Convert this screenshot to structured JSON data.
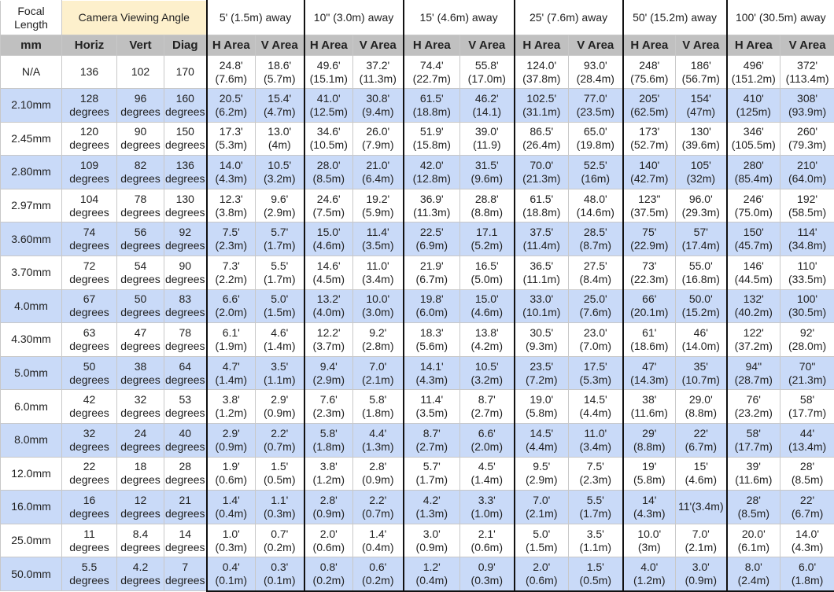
{
  "header": {
    "focal_length": "Focal Length",
    "camera_viewing_angle": "Camera Viewing Angle",
    "distances": [
      "5' (1.5m) away",
      "10\" (3.0m) away",
      "15' (4.6m) away",
      "25' (7.6m) away",
      "50' (15.2m) away",
      "100' (30.5m) away"
    ]
  },
  "subheader": {
    "mm": "mm",
    "horiz": "Horiz",
    "vert": "Vert",
    "diag": "Diag",
    "h_area": "H Area",
    "v_area": "V Area"
  },
  "colors": {
    "angle_header_bg": "#fdf0cc",
    "subheader_bg": "#c0c0c0",
    "stripe_bg": "#c9daf8"
  },
  "rows": [
    {
      "focal": "N/A",
      "horiz": [
        "136"
      ],
      "vert": [
        "102"
      ],
      "diag": [
        "170"
      ],
      "areas": [
        [
          "24.8'",
          "(7.6m)"
        ],
        [
          "18.6'",
          "(5.7m)"
        ],
        [
          "49.6'",
          "(15.1m)"
        ],
        [
          "37.2'",
          "(11.3m)"
        ],
        [
          "74.4'",
          "(22.7m)"
        ],
        [
          "55.8'",
          "(17.0m)"
        ],
        [
          "124.0'",
          "(37.8m)"
        ],
        [
          "93.0'",
          "(28.4m)"
        ],
        [
          "248'",
          "(75.6m)"
        ],
        [
          "186'",
          "(56.7m)"
        ],
        [
          "496'",
          "(151.2m)"
        ],
        [
          "372'",
          "(113.4m)"
        ]
      ]
    },
    {
      "focal": "2.10mm",
      "horiz": [
        "128",
        "degrees"
      ],
      "vert": [
        "96",
        "degrees"
      ],
      "diag": [
        "160",
        "degrees"
      ],
      "areas": [
        [
          "20.5'",
          "(6.2m)"
        ],
        [
          "15.4'",
          "(4.7m)"
        ],
        [
          "41.0'",
          "(12.5m)"
        ],
        [
          "30.8'",
          "(9.4m)"
        ],
        [
          "61.5'",
          "(18.8m)"
        ],
        [
          "46.2'",
          "(14.1)"
        ],
        [
          "102.5'",
          "(31.1m)"
        ],
        [
          "77.0'",
          "(23.5m)"
        ],
        [
          "205'",
          "(62.5m)"
        ],
        [
          "154'",
          "(47m)"
        ],
        [
          "410'",
          "(125m)"
        ],
        [
          "308'",
          "(93.9m)"
        ]
      ]
    },
    {
      "focal": "2.45mm",
      "horiz": [
        "120",
        "degrees"
      ],
      "vert": [
        "90",
        "degrees"
      ],
      "diag": [
        "150",
        "degrees"
      ],
      "areas": [
        [
          "17.3'",
          "(5.3m)"
        ],
        [
          "13.0'",
          "(4m)"
        ],
        [
          "34.6'",
          "(10.5m)"
        ],
        [
          "26.0'",
          "(7.9m)"
        ],
        [
          "51.9'",
          "(15.8m)"
        ],
        [
          "39.0'",
          "(11.9)"
        ],
        [
          "86.5'",
          "(26.4m)"
        ],
        [
          "65.0'",
          "(19.8m)"
        ],
        [
          "173'",
          "(52.7m)"
        ],
        [
          "130'",
          "(39.6m)"
        ],
        [
          "346'",
          "(105.5m)"
        ],
        [
          "260'",
          "(79.3m)"
        ]
      ]
    },
    {
      "focal": "2.80mm",
      "horiz": [
        "109",
        "degrees"
      ],
      "vert": [
        "82",
        "degrees"
      ],
      "diag": [
        "136",
        "degrees"
      ],
      "areas": [
        [
          "14.0'",
          "(4.3m)"
        ],
        [
          "10.5'",
          "(3.2m)"
        ],
        [
          "28.0'",
          "(8.5m)"
        ],
        [
          "21.0'",
          "(6.4m)"
        ],
        [
          "42.0'",
          "(12.8m)"
        ],
        [
          "31.5'",
          "(9.6m)"
        ],
        [
          "70.0'",
          "(21.3m)"
        ],
        [
          "52.5'",
          "(16m)"
        ],
        [
          "140'",
          "(42.7m)"
        ],
        [
          "105'",
          "(32m)"
        ],
        [
          "280'",
          "(85.4m)"
        ],
        [
          "210'",
          "(64.0m)"
        ]
      ]
    },
    {
      "focal": "2.97mm",
      "horiz": [
        "104",
        "degrees"
      ],
      "vert": [
        "78",
        "degrees"
      ],
      "diag": [
        "130",
        "degrees"
      ],
      "areas": [
        [
          "12.3'",
          "(3.8m)"
        ],
        [
          "9.6'",
          "(2.9m)"
        ],
        [
          "24.6'",
          "(7.5m)"
        ],
        [
          "19.2'",
          "(5.9m)"
        ],
        [
          "36.9'",
          "(11.3m)"
        ],
        [
          "28.8'",
          "(8.8m)"
        ],
        [
          "61.5'",
          "(18.8m)"
        ],
        [
          "48.0'",
          "(14.6m)"
        ],
        [
          "123\"",
          "(37.5m)"
        ],
        [
          "96.0'",
          "(29.3m)"
        ],
        [
          "246'",
          "(75.0m)"
        ],
        [
          "192'",
          "(58.5m)"
        ]
      ]
    },
    {
      "focal": "3.60mm",
      "horiz": [
        "74",
        "degrees"
      ],
      "vert": [
        "56",
        "degrees"
      ],
      "diag": [
        "92",
        "degrees"
      ],
      "areas": [
        [
          "7.5'",
          "(2.3m)"
        ],
        [
          "5.7'",
          "(1.7m)"
        ],
        [
          "15.0'",
          "(4.6m)"
        ],
        [
          "11.4'",
          "(3.5m)"
        ],
        [
          "22.5'",
          "(6.9m)"
        ],
        [
          "17.1",
          "(5.2m)"
        ],
        [
          "37.5'",
          "(11.4m)"
        ],
        [
          "28.5'",
          "(8.7m)"
        ],
        [
          "75'",
          "(22.9m)"
        ],
        [
          "57'",
          "(17.4m)"
        ],
        [
          "150'",
          "(45.7m)"
        ],
        [
          "114'",
          "(34.8m)"
        ]
      ]
    },
    {
      "focal": "3.70mm",
      "horiz": [
        "72",
        "degrees"
      ],
      "vert": [
        "54",
        "degrees"
      ],
      "diag": [
        "90",
        "degrees"
      ],
      "areas": [
        [
          "7.3'",
          "(2.2m)"
        ],
        [
          "5.5'",
          "(1.7m)"
        ],
        [
          "14.6'",
          "(4.5m)"
        ],
        [
          "11.0'",
          "(3.4m)"
        ],
        [
          "21.9'",
          "(6.7m)"
        ],
        [
          "16.5'",
          "(5.0m)"
        ],
        [
          "36.5'",
          "(11.1m)"
        ],
        [
          "27.5'",
          "(8.4m)"
        ],
        [
          "73'",
          "(22.3m)"
        ],
        [
          "55.0'",
          "(16.8m)"
        ],
        [
          "146'",
          "(44.5m)"
        ],
        [
          "110'",
          "(33.5m)"
        ]
      ]
    },
    {
      "focal": "4.0mm",
      "horiz": [
        "67",
        "degrees"
      ],
      "vert": [
        "50",
        "degrees"
      ],
      "diag": [
        "83",
        "degrees"
      ],
      "areas": [
        [
          "6.6'",
          "(2.0m)"
        ],
        [
          "5.0'",
          "(1.5m)"
        ],
        [
          "13.2'",
          "(4.0m)"
        ],
        [
          "10.0'",
          "(3.0m)"
        ],
        [
          "19.8'",
          "(6.0m)"
        ],
        [
          "15.0'",
          "(4.6m)"
        ],
        [
          "33.0'",
          "(10.1m)"
        ],
        [
          "25.0'",
          "(7.6m)"
        ],
        [
          "66'",
          "(20.1m)"
        ],
        [
          "50.0'",
          "(15.2m)"
        ],
        [
          "132'",
          "(40.2m)"
        ],
        [
          "100'",
          "(30.5m)"
        ]
      ]
    },
    {
      "focal": "4.30mm",
      "horiz": [
        "63",
        "degrees"
      ],
      "vert": [
        "47",
        "degrees"
      ],
      "diag": [
        "78",
        "degrees"
      ],
      "areas": [
        [
          "6.1'",
          "(1.9m)"
        ],
        [
          "4.6'",
          "(1.4m)"
        ],
        [
          "12.2'",
          "(3.7m)"
        ],
        [
          "9.2'",
          "(2.8m)"
        ],
        [
          "18.3'",
          "(5.6m)"
        ],
        [
          "13.8'",
          "(4.2m)"
        ],
        [
          "30.5'",
          "(9.3m)"
        ],
        [
          "23.0'",
          "(7.0m)"
        ],
        [
          "61'",
          "(18.6m)"
        ],
        [
          "46'",
          "(14.0m)"
        ],
        [
          "122'",
          "(37.2m)"
        ],
        [
          "92'",
          "(28.0m)"
        ]
      ]
    },
    {
      "focal": "5.0mm",
      "horiz": [
        "50",
        "degrees"
      ],
      "vert": [
        "38",
        "degrees"
      ],
      "diag": [
        "64",
        "degrees"
      ],
      "areas": [
        [
          "4.7'",
          "(1.4m)"
        ],
        [
          "3.5'",
          "(1.1m)"
        ],
        [
          "9.4'",
          "(2.9m)"
        ],
        [
          "7.0'",
          "(2.1m)"
        ],
        [
          "14.1'",
          "(4.3m)"
        ],
        [
          "10.5'",
          "(3.2m)"
        ],
        [
          "23.5'",
          "(7.2m)"
        ],
        [
          "17.5'",
          "(5.3m)"
        ],
        [
          "47'",
          "(14.3m)"
        ],
        [
          "35'",
          "(10.7m)"
        ],
        [
          "94\"",
          "(28.7m)"
        ],
        [
          "70\"",
          "(21.3m)"
        ]
      ]
    },
    {
      "focal": "6.0mm",
      "horiz": [
        "42",
        "degrees"
      ],
      "vert": [
        "32",
        "degrees"
      ],
      "diag": [
        "53",
        "degrees"
      ],
      "areas": [
        [
          "3.8'",
          "(1.2m)"
        ],
        [
          "2.9'",
          "(0.9m)"
        ],
        [
          "7.6'",
          "(2.3m)"
        ],
        [
          "5.8'",
          "(1.8m)"
        ],
        [
          "11.4'",
          "(3.5m)"
        ],
        [
          "8.7'",
          "(2.7m)"
        ],
        [
          "19.0'",
          "(5.8m)"
        ],
        [
          "14.5'",
          "(4.4m)"
        ],
        [
          "38'",
          "(11.6m)"
        ],
        [
          "29.0'",
          "(8.8m)"
        ],
        [
          "76'",
          "(23.2m)"
        ],
        [
          "58'",
          "(17.7m)"
        ]
      ]
    },
    {
      "focal": "8.0mm",
      "horiz": [
        "32",
        "degrees"
      ],
      "vert": [
        "24",
        "degrees"
      ],
      "diag": [
        "40",
        "degrees"
      ],
      "areas": [
        [
          "2.9'",
          "(0.9m)"
        ],
        [
          "2.2'",
          "(0.7m)"
        ],
        [
          "5.8'",
          "(1.8m)"
        ],
        [
          "4.4'",
          "(1.3m)"
        ],
        [
          "8.7'",
          "(2.7m)"
        ],
        [
          "6.6'",
          "(2.0m)"
        ],
        [
          "14.5'",
          "(4.4m)"
        ],
        [
          "11.0'",
          "(3.4m)"
        ],
        [
          "29'",
          "(8.8m)"
        ],
        [
          "22'",
          "(6.7m)"
        ],
        [
          "58'",
          "(17.7m)"
        ],
        [
          "44'",
          "(13.4m)"
        ]
      ]
    },
    {
      "focal": "12.0mm",
      "horiz": [
        "22",
        "degrees"
      ],
      "vert": [
        "18",
        "degrees"
      ],
      "diag": [
        "28",
        "degrees"
      ],
      "areas": [
        [
          "1.9'",
          "(0.6m)"
        ],
        [
          "1.5'",
          "(0.5m)"
        ],
        [
          "3.8'",
          "(1.2m)"
        ],
        [
          "2.8'",
          "(0.9m)"
        ],
        [
          "5.7'",
          "(1.7m)"
        ],
        [
          "4.5'",
          "(1.4m)"
        ],
        [
          "9.5'",
          "(2.9m)"
        ],
        [
          "7.5'",
          "(2.3m)"
        ],
        [
          "19'",
          "(5.8m)"
        ],
        [
          "15'",
          "(4.6m)"
        ],
        [
          "39'",
          "(11.6m)"
        ],
        [
          "28'",
          "(8.5m)"
        ]
      ]
    },
    {
      "focal": "16.0mm",
      "horiz": [
        "16",
        "degrees"
      ],
      "vert": [
        "12",
        "degrees"
      ],
      "diag": [
        "21",
        "degrees"
      ],
      "areas": [
        [
          "1.4'",
          "(0.4m)"
        ],
        [
          "1.1'",
          "(0.3m)"
        ],
        [
          "2.8'",
          "(0.9m)"
        ],
        [
          "2.2'",
          "(0.7m)"
        ],
        [
          "4.2'",
          "(1.3m)"
        ],
        [
          "3.3'",
          "(1.0m)"
        ],
        [
          "7.0'",
          "(2.1m)"
        ],
        [
          "5.5'",
          "(1.7m)"
        ],
        [
          "14'",
          "(4.3m)"
        ],
        [
          "11'(3.4m)"
        ],
        [
          "28'",
          "(8.5m)"
        ],
        [
          "22'",
          "(6.7m)"
        ]
      ]
    },
    {
      "focal": "25.0mm",
      "horiz": [
        "11",
        "degrees"
      ],
      "vert": [
        "8.4",
        "degrees"
      ],
      "diag": [
        "14",
        "degrees"
      ],
      "areas": [
        [
          "1.0'",
          "(0.3m)"
        ],
        [
          "0.7'",
          "(0.2m)"
        ],
        [
          "2.0'",
          "(0.6m)"
        ],
        [
          "1.4'",
          "(0.4m)"
        ],
        [
          "3.0'",
          "(0.9m)"
        ],
        [
          "2.1'",
          "(0.6m)"
        ],
        [
          "5.0'",
          "(1.5m)"
        ],
        [
          "3.5'",
          "(1.1m)"
        ],
        [
          "10.0'",
          "(3m)"
        ],
        [
          "7.0'",
          "(2.1m)"
        ],
        [
          "20.0'",
          "(6.1m)"
        ],
        [
          "14.0'",
          "(4.3m)"
        ]
      ]
    },
    {
      "focal": "50.0mm",
      "horiz": [
        "5.5",
        "degrees"
      ],
      "vert": [
        "4.2",
        "degrees"
      ],
      "diag": [
        "7",
        "degrees"
      ],
      "areas": [
        [
          "0.4'",
          "(0.1m)"
        ],
        [
          "0.3'",
          "(0.1m)"
        ],
        [
          "0.8'",
          "(0.2m)"
        ],
        [
          "0.6'",
          "(0.2m)"
        ],
        [
          "1.2'",
          "(0.4m)"
        ],
        [
          "0.9'",
          "(0.3m)"
        ],
        [
          "2.0'",
          "(0.6m)"
        ],
        [
          "1.5'",
          "(0.5m)"
        ],
        [
          "4.0'",
          "(1.2m)"
        ],
        [
          "3.0'",
          "(0.9m)"
        ],
        [
          "8.0'",
          "(2.4m)"
        ],
        [
          "6.0'",
          "(1.8m)"
        ]
      ]
    }
  ]
}
